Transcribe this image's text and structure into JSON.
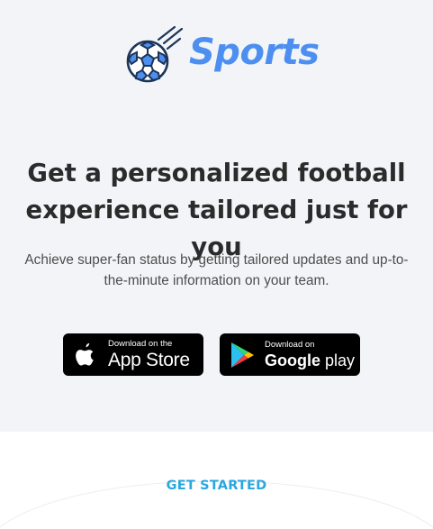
{
  "brand": {
    "name": "Sports",
    "icon": "soccer-ball-icon",
    "color": "#4d8ff0"
  },
  "hero": {
    "headline": "Get a personalized football\nexperience tailored just for you",
    "subtext": "Achieve super-fan status by getting tailored updates and up-to-\nthe-minute information on your team."
  },
  "stores": {
    "apple": {
      "small_label": "Download on the",
      "big_label": "App Store",
      "icon": "apple-icon"
    },
    "google": {
      "small_label": "Download on",
      "big_label_word": "Google",
      "big_label_rest": " play",
      "icon": "google-play-icon"
    }
  },
  "cta": {
    "label": "GET STARTED",
    "color": "#2aa7df"
  },
  "colors": {
    "hero_background": "#f3f4f7",
    "headline": "#2b2b2b",
    "store_button": "#000000"
  }
}
